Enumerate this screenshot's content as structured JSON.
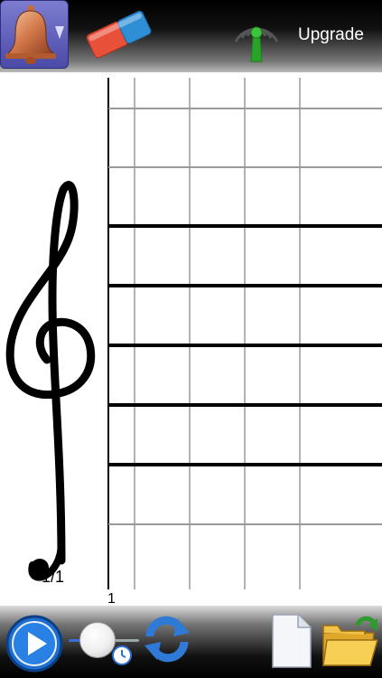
{
  "toolbar": {
    "upgrade_label": "Upgrade",
    "icons": {
      "instrument": "bell-icon",
      "eraser": "eraser-icon",
      "wireless": "antenna-icon"
    }
  },
  "sheet": {
    "page_counter": "1/1",
    "measure_number": "1",
    "clef": "treble-clef"
  },
  "bottom_bar": {
    "icons": {
      "play": "play-icon",
      "tempo": "clock-icon",
      "loop": "loop-arrows-icon",
      "new": "new-document-icon",
      "open": "open-folder-icon"
    }
  },
  "colors": {
    "instrument_button_bg": "#6a6ac4",
    "play_blue": "#1f6fd1",
    "antenna_green": "#28a428",
    "eraser_red": "#e8503a",
    "eraser_blue": "#2f8fd6"
  }
}
